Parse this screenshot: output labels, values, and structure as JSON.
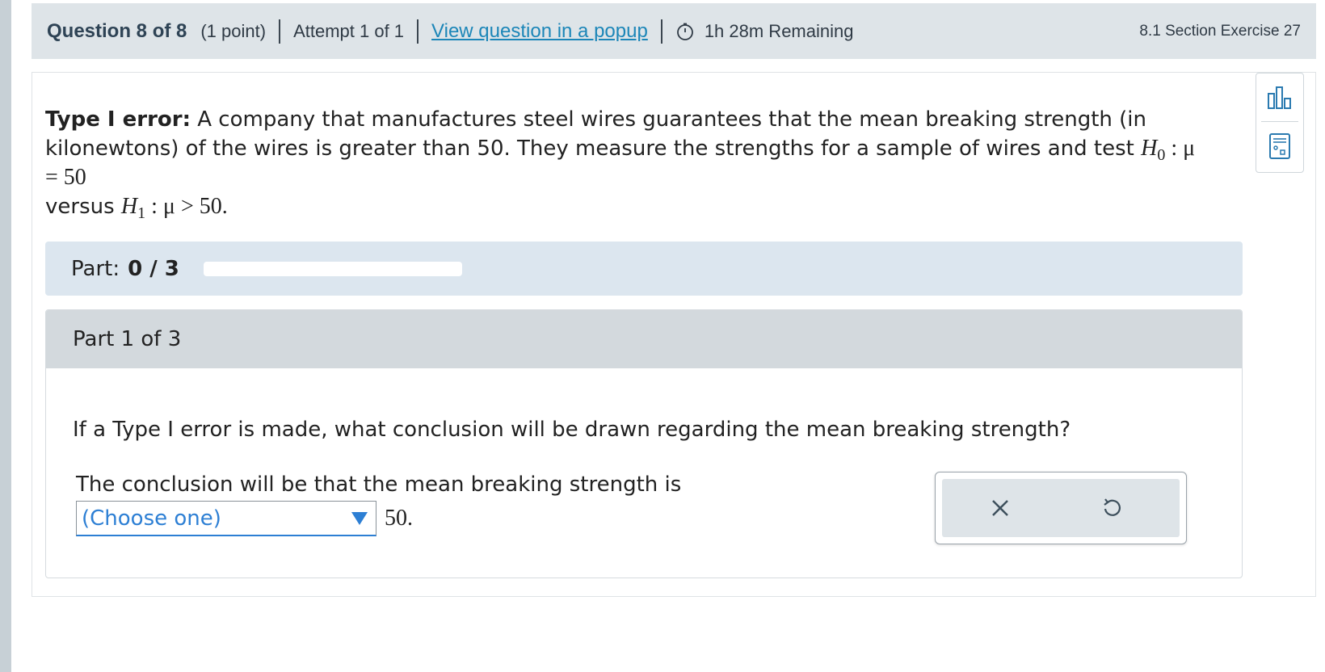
{
  "header": {
    "question_title": "Question 8 of 8",
    "points": "(1 point)",
    "attempt": "Attempt 1 of 1",
    "popup_link": "View question in a popup",
    "timer": "1h 28m Remaining",
    "section_exercise": "8.1 Section Exercise 27"
  },
  "prompt": {
    "bold_label": "Type I error:",
    "text": " A company that manufactures steel wires guarantees that the mean breaking strength (in kilonewtons) of the wires is greater than 50. They measure the strengths for a sample of wires and test ",
    "h0": "H",
    "h0_sub": "0",
    "h0_rest": " : μ = 50",
    "versus": " versus ",
    "h1": "H",
    "h1_sub": "1",
    "h1_rest": " : μ > 50."
  },
  "tools": {
    "icon_1": "bar-chart-icon",
    "icon_2": "calculator-icon"
  },
  "progress": {
    "label": "Part:",
    "count": "0 / 3",
    "fraction": 0
  },
  "part": {
    "title": "Part 1 of 3",
    "question": "If a Type I error is made, what conclusion will be drawn regarding the mean breaking strength?",
    "answer_prefix": "The conclusion will be that the mean breaking strength is",
    "select_value": "(Choose one)",
    "after_select": "50."
  },
  "actions": {
    "clear_icon": "close-icon",
    "reset_icon": "undo-icon"
  },
  "colors": {
    "link": "#1c86b8",
    "select_accent": "#2d7fd4",
    "header_bg": "#dee4e8",
    "strip_bg": "#dce6ef"
  }
}
